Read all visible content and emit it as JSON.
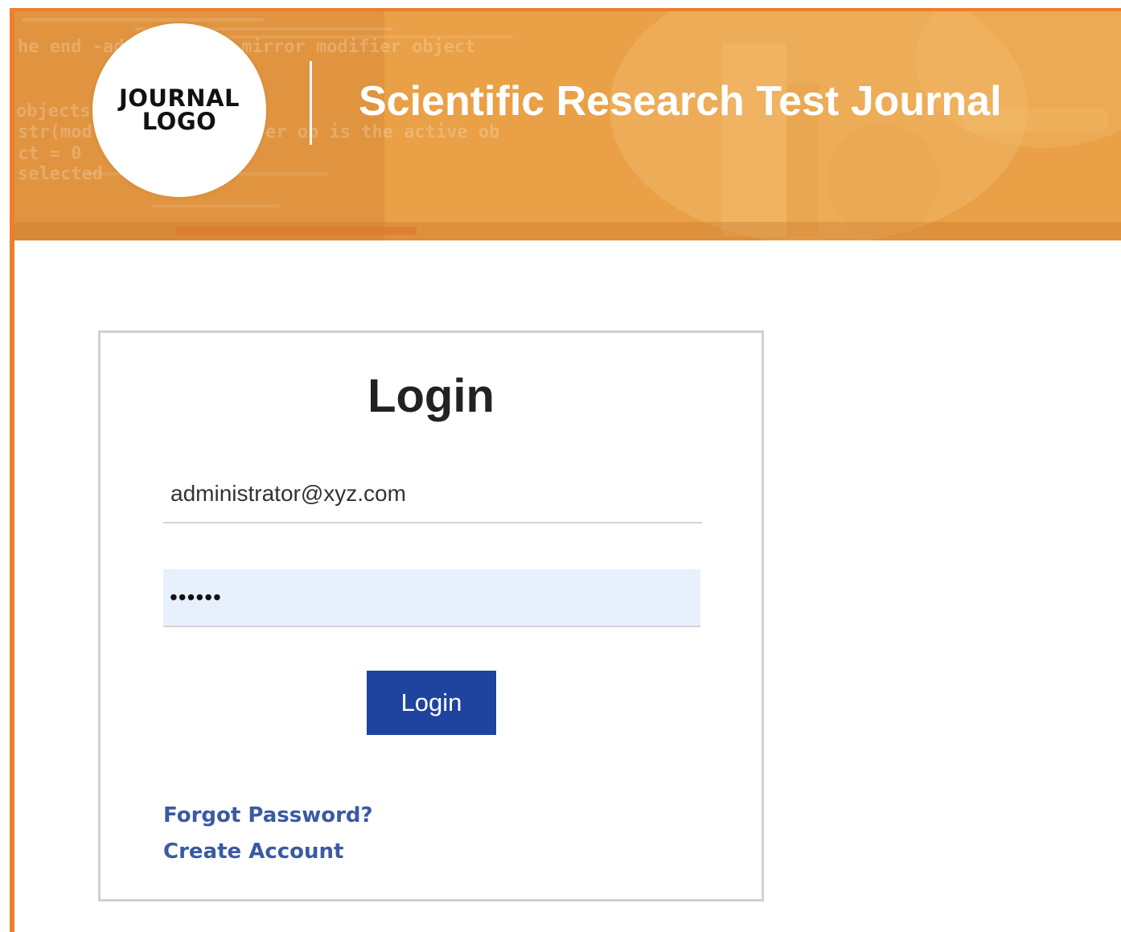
{
  "header": {
    "logo_line1": "JOURNAL",
    "logo_line2": "LOGO",
    "title": "Scientific Research Test Journal",
    "banner_background_text": [
      "he end -add selected mirror modifier object",
      "objects.",
      "str(mod",
      "er ob is the active ob",
      "ct = 0",
      "selected"
    ]
  },
  "login_form": {
    "heading": "Login",
    "email_value": "administrator@xyz.com",
    "password_value": "••••••",
    "submit_label": "Login",
    "forgot_password_label": "Forgot Password?",
    "create_account_label": "Create Account"
  },
  "colors": {
    "accent_orange": "#ee7d2d",
    "button_blue": "#1f44a0",
    "link_blue": "#3a5aa4",
    "autofill_background": "#e8f0fe"
  }
}
